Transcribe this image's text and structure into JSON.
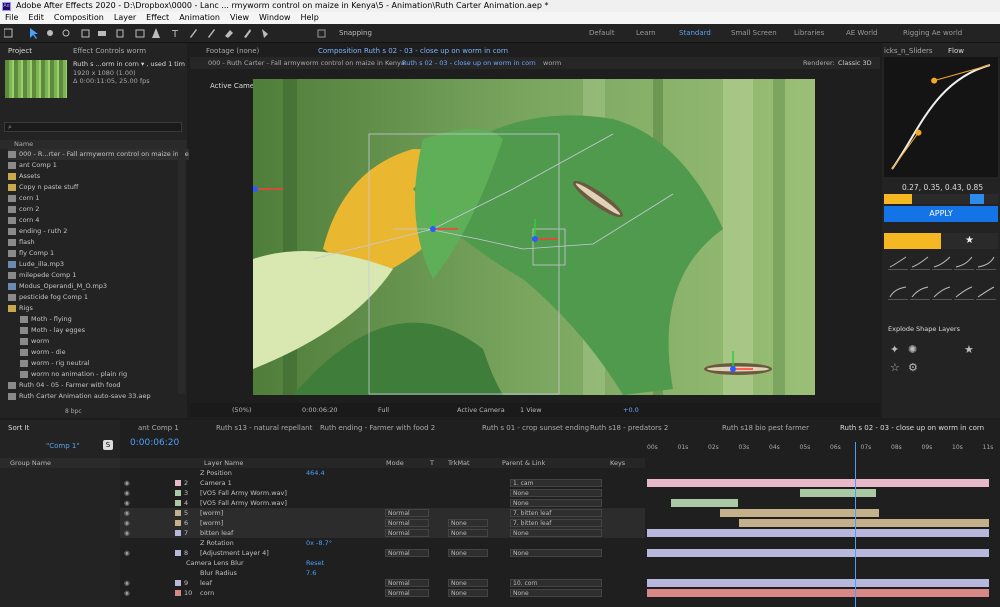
{
  "window": {
    "title": "Adobe After Effects 2020 - D:\\Dropbox\\0000 - Lanc ... rmyworm control on maize in Kenya\\5 - Animation\\Ruth Carter Animation.aep *"
  },
  "menu": [
    "File",
    "Edit",
    "Composition",
    "Layer",
    "Effect",
    "Animation",
    "View",
    "Window",
    "Help"
  ],
  "toolbar": {
    "snapping": "Snapping"
  },
  "workspaces": [
    "Default",
    "Learn",
    "Standard",
    "Small Screen",
    "Libraries",
    "AE World",
    "Rigging Ae world"
  ],
  "project": {
    "tabs": [
      "Project",
      "Effect Controls worm"
    ],
    "item_name": "Ruth s ...orm in corn ▾ , used 1 time",
    "item_info": [
      "1920 x 1080 (1.00)",
      "Δ 0:00:11:05, 25.00 fps"
    ],
    "search_placeholder": "",
    "column": "Name",
    "items": [
      {
        "name": "000 - R...rter - Fall armyworm control on maize in Ke",
        "type": "comp",
        "indent": 0
      },
      {
        "name": "ant Comp 1",
        "type": "comp",
        "indent": 0
      },
      {
        "name": "Assets",
        "type": "folder",
        "indent": 0
      },
      {
        "name": "Copy n paste stuff",
        "type": "folder",
        "indent": 0
      },
      {
        "name": "corn 1",
        "type": "comp",
        "indent": 0
      },
      {
        "name": "corn 2",
        "type": "comp",
        "indent": 0
      },
      {
        "name": "corn 4",
        "type": "comp",
        "indent": 0
      },
      {
        "name": "ending - ruth 2",
        "type": "comp",
        "indent": 0
      },
      {
        "name": "flash",
        "type": "comp",
        "indent": 0
      },
      {
        "name": "fly Comp 1",
        "type": "comp",
        "indent": 0
      },
      {
        "name": "Lude_illa.mp3",
        "type": "audio",
        "indent": 0
      },
      {
        "name": "milepede Comp 1",
        "type": "comp",
        "indent": 0
      },
      {
        "name": "Modus_Operandi_M_O.mp3",
        "type": "audio",
        "indent": 0
      },
      {
        "name": "pesticide fog Comp 1",
        "type": "comp",
        "indent": 0
      },
      {
        "name": "Rigs",
        "type": "folder",
        "indent": 0
      },
      {
        "name": "Moth - flying",
        "type": "comp",
        "indent": 1
      },
      {
        "name": "Moth - lay egges",
        "type": "comp",
        "indent": 1
      },
      {
        "name": "worm",
        "type": "comp",
        "indent": 1
      },
      {
        "name": "worm - die",
        "type": "comp",
        "indent": 1
      },
      {
        "name": "worm - rig neutral",
        "type": "comp",
        "indent": 1
      },
      {
        "name": "worm no animation - plain rig",
        "type": "comp",
        "indent": 1
      },
      {
        "name": "Ruth 04 - 05 - Farmer with food",
        "type": "comp",
        "indent": 0
      },
      {
        "name": "Ruth Carter Animation auto-save 33.aep",
        "type": "file",
        "indent": 0
      }
    ],
    "bpc": "8 bpc"
  },
  "viewer": {
    "tabs": [
      "Footage (none)",
      "Composition Ruth s 02 - 03 - close up on worm in corn"
    ],
    "breadcrumb": [
      "000 - Ruth Carter - Fall armyworm control on maize in Kenya",
      "Ruth s 02 - 03 - close up on worm in corn",
      "worm"
    ],
    "renderer": "Renderer:",
    "renderer_value": "Classic 3D",
    "camera_label": "Active Camera",
    "footer": {
      "zoom": "(50%)",
      "time": "0:00:06:20",
      "res": "Full",
      "view": "Active Camera",
      "views": "1 View",
      "exposure": "+0.0"
    }
  },
  "flow": {
    "tabs": [
      "icks_n_Sliders",
      "Flow"
    ],
    "values": "0.27, 0.35, 0.43, 0.85",
    "apply": "APPLY",
    "explode_title": "Explode Shape Layers",
    "curve": [
      0.27,
      0.35,
      0.43,
      0.85
    ]
  },
  "sortit": {
    "title": "Sort It",
    "comp": "\"Comp 1\"",
    "group_header": "Group Name"
  },
  "timeline": {
    "tabs": [
      "ant Comp 1",
      "Ruth s13 - natural repellant",
      "Ruth ending - Farmer with food 2",
      "Ruth s 01 - crop sunset ending",
      "Ruth s18 - predators 2",
      "Ruth s18 bio pest farmer",
      "Ruth s 02 - 03 - close up on worm in corn"
    ],
    "timecode": "0:00:06:20",
    "columns": {
      "layer_name": "Layer Name",
      "mode": "Mode",
      "t": "T",
      "trkmat": "TrkMat",
      "parent": "Parent & Link",
      "keys": "Keys"
    },
    "ruler": [
      "00s",
      "01s",
      "02s",
      "03s",
      "04s",
      "05s",
      "06s",
      "07s",
      "08s",
      "09s",
      "10s",
      "11s"
    ],
    "rows": [
      {
        "kind": "prop",
        "name": "Z Position",
        "value": "464.4"
      },
      {
        "kind": "layer",
        "num": "2",
        "name": "Camera 1",
        "mode": "",
        "trkmat": "",
        "parent": "1. cam",
        "color": "#e6b8c8"
      },
      {
        "kind": "layer",
        "num": "3",
        "name": "[VO5 Fall Army Worm.wav]",
        "mode": "",
        "trkmat": "",
        "parent": "None",
        "color": "#a9c8a4"
      },
      {
        "kind": "layer",
        "num": "4",
        "name": "[VO5 Fall Army Worm.wav]",
        "mode": "",
        "trkmat": "",
        "parent": "None",
        "color": "#a9c8a4"
      },
      {
        "kind": "layer",
        "num": "5",
        "name": "[worm]",
        "mode": "Normal",
        "trkmat": "",
        "parent": "7. bitten leaf",
        "color": "#c4b08a"
      },
      {
        "kind": "layer",
        "num": "6",
        "name": "[worm]",
        "mode": "Normal",
        "trkmat": "None",
        "parent": "7. bitten leaf",
        "color": "#c4b08a"
      },
      {
        "kind": "layer",
        "num": "7",
        "name": "bitten leaf",
        "mode": "Normal",
        "trkmat": "None",
        "parent": "None",
        "color": "#b8b8dc"
      },
      {
        "kind": "prop",
        "name": "Z Rotation",
        "value": "0x -8.7°"
      },
      {
        "kind": "layer",
        "num": "8",
        "name": "[Adjustment Layer 4]",
        "mode": "Normal",
        "trkmat": "None",
        "parent": "None",
        "color": "#b8b8dc"
      },
      {
        "kind": "fx",
        "name": "Camera Lens Blur",
        "value": "Reset"
      },
      {
        "kind": "prop",
        "name": "Blur Radius",
        "value": "7.6"
      },
      {
        "kind": "layer",
        "num": "9",
        "name": "leaf",
        "mode": "Normal",
        "trkmat": "None",
        "parent": "10. corn",
        "color": "#b8b8dc"
      },
      {
        "kind": "layer",
        "num": "10",
        "name": "corn",
        "mode": "Normal",
        "trkmat": "None",
        "parent": "None",
        "color": "#d98888"
      }
    ]
  },
  "colors": {
    "accent": "#2d8ceb",
    "apply": "#1473e6",
    "playhead": "#4aa0ff",
    "leaf": "#5aa556",
    "corn": "#e9b830"
  }
}
